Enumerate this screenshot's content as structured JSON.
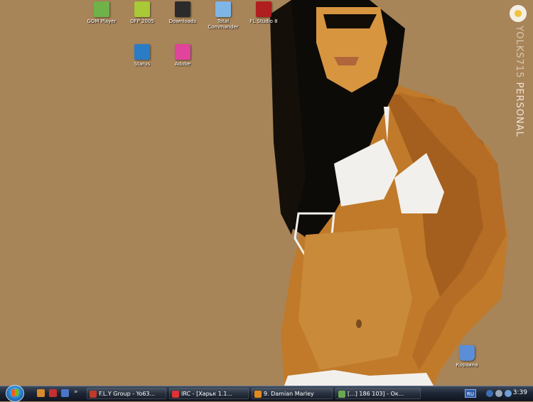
{
  "desktop": {
    "icons": [
      {
        "label": "GOM Player",
        "icon": "gom-player-icon",
        "color": "#6fb24a"
      },
      {
        "label": "OFP 2005",
        "icon": "ofp-icon",
        "color": "#a9c936"
      },
      {
        "label": "Downloads",
        "icon": "downloads-icon",
        "color": "#2b2b2b"
      },
      {
        "label": "Total Commander",
        "icon": "total-commander-icon",
        "color": "#7fb6e8"
      },
      {
        "label": "FL Studio 8",
        "icon": "fl-studio-icon",
        "color": "#b01f1f"
      },
      {
        "label": "Starus",
        "icon": "starus-icon",
        "color": "#2a7cc7"
      },
      {
        "label": "Adobe",
        "icon": "adobe-icon",
        "color": "#e0449c"
      },
      {
        "label": "Корзина",
        "icon": "recycle-bin-icon",
        "color": "#5b8ed6"
      }
    ]
  },
  "branding": {
    "text_yolk": "YOLKS715",
    "text_personal": "PERSONAL",
    "icon": "yolks-logo-icon"
  },
  "taskbar": {
    "start_icon": "windows-start-orb-icon",
    "quicklaunch": [
      {
        "icon": "quicklaunch-app-1-icon",
        "color": "#d98a2b"
      },
      {
        "icon": "quicklaunch-app-2-icon",
        "color": "#c43030"
      },
      {
        "icon": "quicklaunch-app-3-icon",
        "color": "#4a76c9"
      }
    ],
    "overflow_label": "»",
    "tasks": [
      {
        "label": "F.L.Y Group - Yo63...",
        "icon": "fly-group-icon",
        "color": "#c0392b"
      },
      {
        "label": "IRC - [Харьк 1.1...",
        "icon": "irc-icon",
        "color": "#d33"
      },
      {
        "label": "9. Damian Marley",
        "icon": "music-player-icon",
        "color": "#e08a1e"
      },
      {
        "label": "[...] 186 103] - Ок...",
        "icon": "network-window-icon",
        "color": "#6aa84f"
      }
    ],
    "tray": {
      "language": "RU",
      "clock": "3:39",
      "icons": [
        "help-icon",
        "volume-icon",
        "network-icon"
      ]
    }
  },
  "colors": {
    "background": "#a88459",
    "taskbar": "#1d2635"
  }
}
